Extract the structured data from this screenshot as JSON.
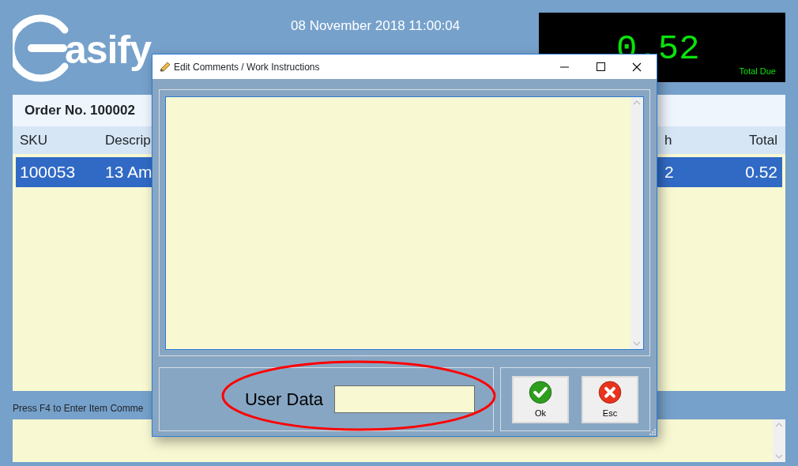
{
  "header": {
    "logo_text": "asify",
    "datetime": "08 November 2018 11:00:04",
    "total": {
      "amount": "0.52",
      "label": "Total Due"
    }
  },
  "order": {
    "title": "Order No. 100002",
    "columns": [
      "SKU",
      "Descrip",
      "h",
      "Total"
    ],
    "rows": [
      {
        "cells": [
          "100053",
          "13 Am",
          "2",
          "0.52"
        ],
        "selected": true
      }
    ]
  },
  "status_text": "Press F4 to Enter Item Comme",
  "dialog": {
    "title": "Edit Comments / Work Instructions",
    "user_data": {
      "label": "User Data"
    },
    "buttons": [
      {
        "label": "Ok",
        "kind": "ok"
      },
      {
        "label": "Esc",
        "kind": "cancel"
      }
    ]
  }
}
